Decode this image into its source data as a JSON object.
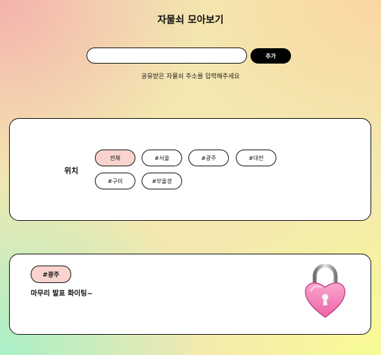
{
  "header": {
    "title": "자물쇠 모아보기"
  },
  "add_form": {
    "input_value": "",
    "input_placeholder": "",
    "add_label": "추가",
    "hint": "공유받은 자물쇠 주소를 입력해주세요"
  },
  "filter": {
    "label": "위치",
    "options": [
      {
        "label": "전체",
        "selected": true
      },
      {
        "label": "#서울",
        "selected": false
      },
      {
        "label": "#광주",
        "selected": false
      },
      {
        "label": "#대전",
        "selected": false
      },
      {
        "label": "#구미",
        "selected": false
      },
      {
        "label": "#부울경",
        "selected": false
      }
    ]
  },
  "posts": [
    {
      "tag": "#광주",
      "message": "마무리 발표 화이팅~",
      "icon": "heart-lock-icon"
    }
  ],
  "colors": {
    "chip_selected": "#f9d3cd",
    "button_dark": "#000000",
    "heart_pink": "#f47cb4"
  }
}
